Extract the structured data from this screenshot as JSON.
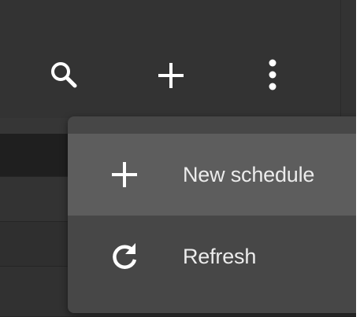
{
  "toolbar": {
    "search_icon": "search-icon",
    "add_icon": "plus-icon",
    "more_icon": "more-vert-icon"
  },
  "menu": {
    "items": [
      {
        "label": "New schedule",
        "icon": "plus-icon",
        "state": "hovered"
      },
      {
        "label": "Refresh",
        "icon": "refresh-icon"
      }
    ]
  },
  "colors": {
    "toolbar_bg": "#333333",
    "menu_bg": "#474747",
    "menu_hover": "#5d5d5d",
    "text": "#ececec",
    "icon": "#ffffff"
  }
}
